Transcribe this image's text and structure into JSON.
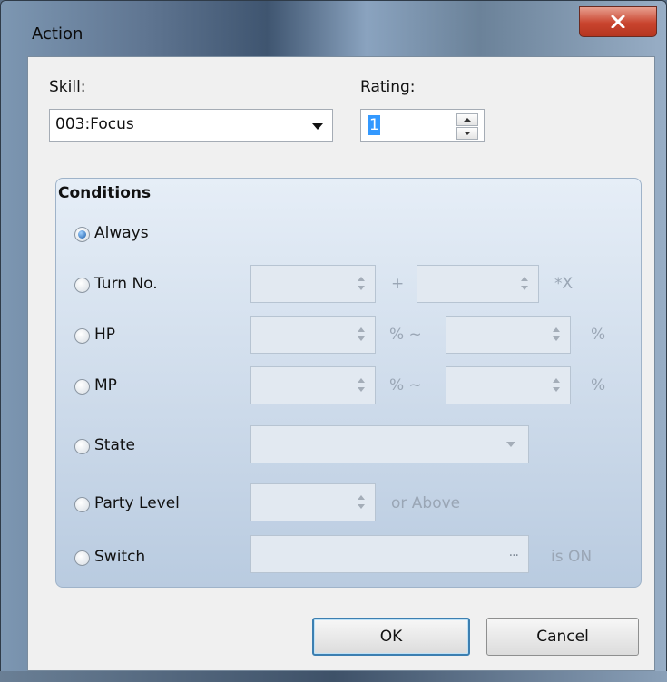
{
  "window": {
    "title": "Action",
    "close_glyph": "X"
  },
  "skill": {
    "label": "Skill:",
    "value": "003:Focus"
  },
  "rating": {
    "label": "Rating:",
    "value": "1"
  },
  "conditions": {
    "title": "Conditions",
    "selected": "Always",
    "options": [
      {
        "label": "Always",
        "checked": true
      },
      {
        "label": "Turn No.",
        "plus": "+",
        "suffix": "*X"
      },
      {
        "label": "HP",
        "tilde": "% ~",
        "suffix": "%"
      },
      {
        "label": "MP",
        "tilde": "% ~",
        "suffix": "%"
      },
      {
        "label": "State"
      },
      {
        "label": "Party Level",
        "suffix": "or Above"
      },
      {
        "label": "Switch",
        "browse_glyph": "...",
        "suffix": "is ON"
      }
    ]
  },
  "buttons": {
    "ok": "OK",
    "cancel": "Cancel"
  },
  "icons": {
    "close": "close-icon",
    "dropdown": "chevron-down-icon",
    "spin_up": "spin-up-icon",
    "spin_down": "spin-down-icon",
    "browse": "ellipsis-icon"
  },
  "colors": {
    "close_button": "#c9442e",
    "selection": "#3399ff",
    "disabled_text": "#9aa6b5",
    "default_button_border": "#3c7fb1"
  }
}
